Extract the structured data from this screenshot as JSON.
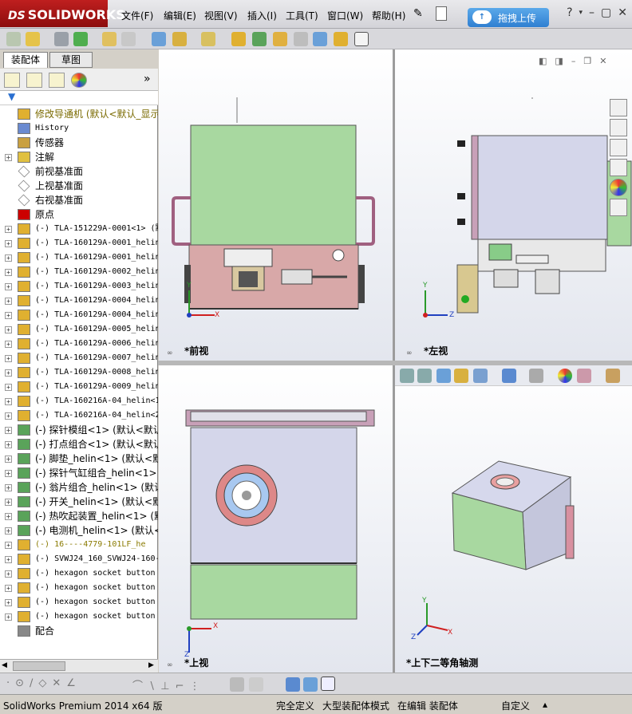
{
  "app": {
    "logo": "SOLIDWORKS",
    "logo_prefix": "DS"
  },
  "menu": {
    "file": "文件(F)",
    "edit": "编辑(E)",
    "view": "视图(V)",
    "insert": "插入(I)",
    "tools": "工具(T)",
    "window": "窗口(W)",
    "help": "帮助(H)"
  },
  "upload": {
    "label": "拖拽上传"
  },
  "panel": {
    "tab_assembly": "装配体",
    "tab_sketch": "草图",
    "collapse": "»"
  },
  "tree": [
    {
      "label": "修改导通机  (默认<默认_显示",
      "type": "assembly-warn",
      "exp": "",
      "cn": true
    },
    {
      "label": "History",
      "type": "history",
      "exp": "",
      "cn": false
    },
    {
      "label": "传感器",
      "type": "sensor",
      "exp": "",
      "cn": true
    },
    {
      "label": "注解",
      "type": "annotation",
      "exp": "+",
      "cn": true
    },
    {
      "label": "前视基准面",
      "type": "plane",
      "exp": "",
      "cn": true
    },
    {
      "label": "上视基准面",
      "type": "plane",
      "exp": "",
      "cn": true
    },
    {
      "label": "右视基准面",
      "type": "plane",
      "exp": "",
      "cn": true
    },
    {
      "label": "原点",
      "type": "origin",
      "exp": "",
      "cn": true
    },
    {
      "label": "(-) TLA-151229A-0001<1> (默",
      "type": "part",
      "exp": "+",
      "cn": false
    },
    {
      "label": "(-) TLA-160129A-0001_helin",
      "type": "part",
      "exp": "+",
      "cn": false
    },
    {
      "label": "(-) TLA-160129A-0001_helin",
      "type": "part",
      "exp": "+",
      "cn": false
    },
    {
      "label": "(-) TLA-160129A-0002_helin",
      "type": "part",
      "exp": "+",
      "cn": false
    },
    {
      "label": "(-) TLA-160129A-0003_helin",
      "type": "part",
      "exp": "+",
      "cn": false
    },
    {
      "label": "(-) TLA-160129A-0004_helin",
      "type": "part",
      "exp": "+",
      "cn": false
    },
    {
      "label": "(-) TLA-160129A-0004_helin",
      "type": "part",
      "exp": "+",
      "cn": false
    },
    {
      "label": "(-) TLA-160129A-0005_helin",
      "type": "part",
      "exp": "+",
      "cn": false
    },
    {
      "label": "(-) TLA-160129A-0006_helin",
      "type": "part",
      "exp": "+",
      "cn": false
    },
    {
      "label": "(-) TLA-160129A-0007_helin",
      "type": "part",
      "exp": "+",
      "cn": false
    },
    {
      "label": "(-) TLA-160129A-0008_helin",
      "type": "part",
      "exp": "+",
      "cn": false
    },
    {
      "label": "(-) TLA-160129A-0009_helin",
      "type": "part",
      "exp": "+",
      "cn": false
    },
    {
      "label": "(-) TLA-160216A-04_helin<1",
      "type": "part",
      "exp": "+",
      "cn": false
    },
    {
      "label": "(-) TLA-160216A-04_helin<2",
      "type": "part",
      "exp": "+",
      "cn": false
    },
    {
      "label": "(-) 探针模组<1> (默认<默认",
      "type": "assembly",
      "exp": "+",
      "cn": true
    },
    {
      "label": "(-) 打点组合<1> (默认<默认",
      "type": "assembly",
      "exp": "+",
      "cn": true
    },
    {
      "label": "(-) 脚垫_helin<1> (默认<默",
      "type": "assembly",
      "exp": "+",
      "cn": true
    },
    {
      "label": "(-) 探针气缸组合_helin<1>",
      "type": "assembly",
      "exp": "+",
      "cn": true
    },
    {
      "label": "(-) 翁片组合_helin<1> (默认",
      "type": "assembly",
      "exp": "+",
      "cn": true
    },
    {
      "label": "(-) 开关_helin<1> (默认<默",
      "type": "assembly",
      "exp": "+",
      "cn": true
    },
    {
      "label": "(-) 热吹起装置_helin<1> (默",
      "type": "assembly",
      "exp": "+",
      "cn": true
    },
    {
      "label": "(-) 电测机_helin<1> (默认<",
      "type": "assembly",
      "exp": "+",
      "cn": true
    },
    {
      "label": "(-) 16----4779-101LF_he",
      "type": "assembly-warn",
      "exp": "+",
      "cn": false
    },
    {
      "label": "(-) SVWJ24_160_SVWJ24-160-",
      "type": "part",
      "exp": "+",
      "cn": false
    },
    {
      "label": "(-) hexagon socket button",
      "type": "part",
      "exp": "+",
      "cn": false
    },
    {
      "label": "(-) hexagon socket button",
      "type": "part",
      "exp": "+",
      "cn": false
    },
    {
      "label": "(-) hexagon socket button",
      "type": "part",
      "exp": "+",
      "cn": false
    },
    {
      "label": "(-) hexagon socket button",
      "type": "part",
      "exp": "+",
      "cn": false
    },
    {
      "label": "配合",
      "type": "mates",
      "exp": "",
      "cn": true
    }
  ],
  "viewports": {
    "front": "*前视",
    "left": "*左视",
    "top": "*上视",
    "iso": "*上下二等角轴测"
  },
  "axes": {
    "x": "X",
    "y": "Y",
    "z": "Z"
  },
  "status": {
    "product": "SolidWorks Premium 2014 x64 版",
    "defined": "完全定义",
    "large_asm": "大型装配体模式",
    "editing": "在编辑 装配体",
    "custom": "自定义"
  }
}
